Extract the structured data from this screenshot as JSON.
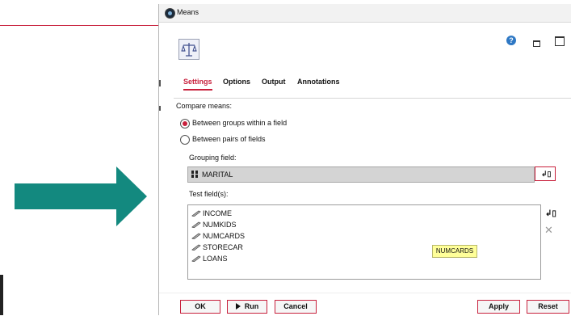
{
  "window": {
    "title": "Means"
  },
  "tabs": [
    {
      "label": "Settings",
      "active": true
    },
    {
      "label": "Options",
      "active": false
    },
    {
      "label": "Output",
      "active": false
    },
    {
      "label": "Annotations",
      "active": false
    }
  ],
  "settings": {
    "compare_label": "Compare means:",
    "options": [
      {
        "label": "Between groups within a field",
        "checked": true
      },
      {
        "label": "Between pairs of fields",
        "checked": false
      }
    ],
    "grouping_label": "Grouping field:",
    "grouping_value": "MARITAL",
    "test_label": "Test field(s):",
    "test_fields": [
      "INCOME",
      "NUMKIDS",
      "NUMCARDS",
      "STORECAR",
      "LOANS"
    ],
    "tooltip": "NUMCARDS"
  },
  "buttons": {
    "ok": "OK",
    "run": "Run",
    "cancel": "Cancel",
    "apply": "Apply",
    "reset": "Reset"
  },
  "icons": {
    "app": "spss-modeler-icon",
    "node": "balance-scale-icon",
    "help": "help-icon",
    "minimize": "minimize-icon",
    "maximize": "maximize-icon",
    "field_picker": "field-picker-icon",
    "remove": "remove-icon"
  },
  "colors": {
    "accent": "#c8203c",
    "arrow": "#13897f",
    "tooltip_bg": "#ffff99"
  }
}
